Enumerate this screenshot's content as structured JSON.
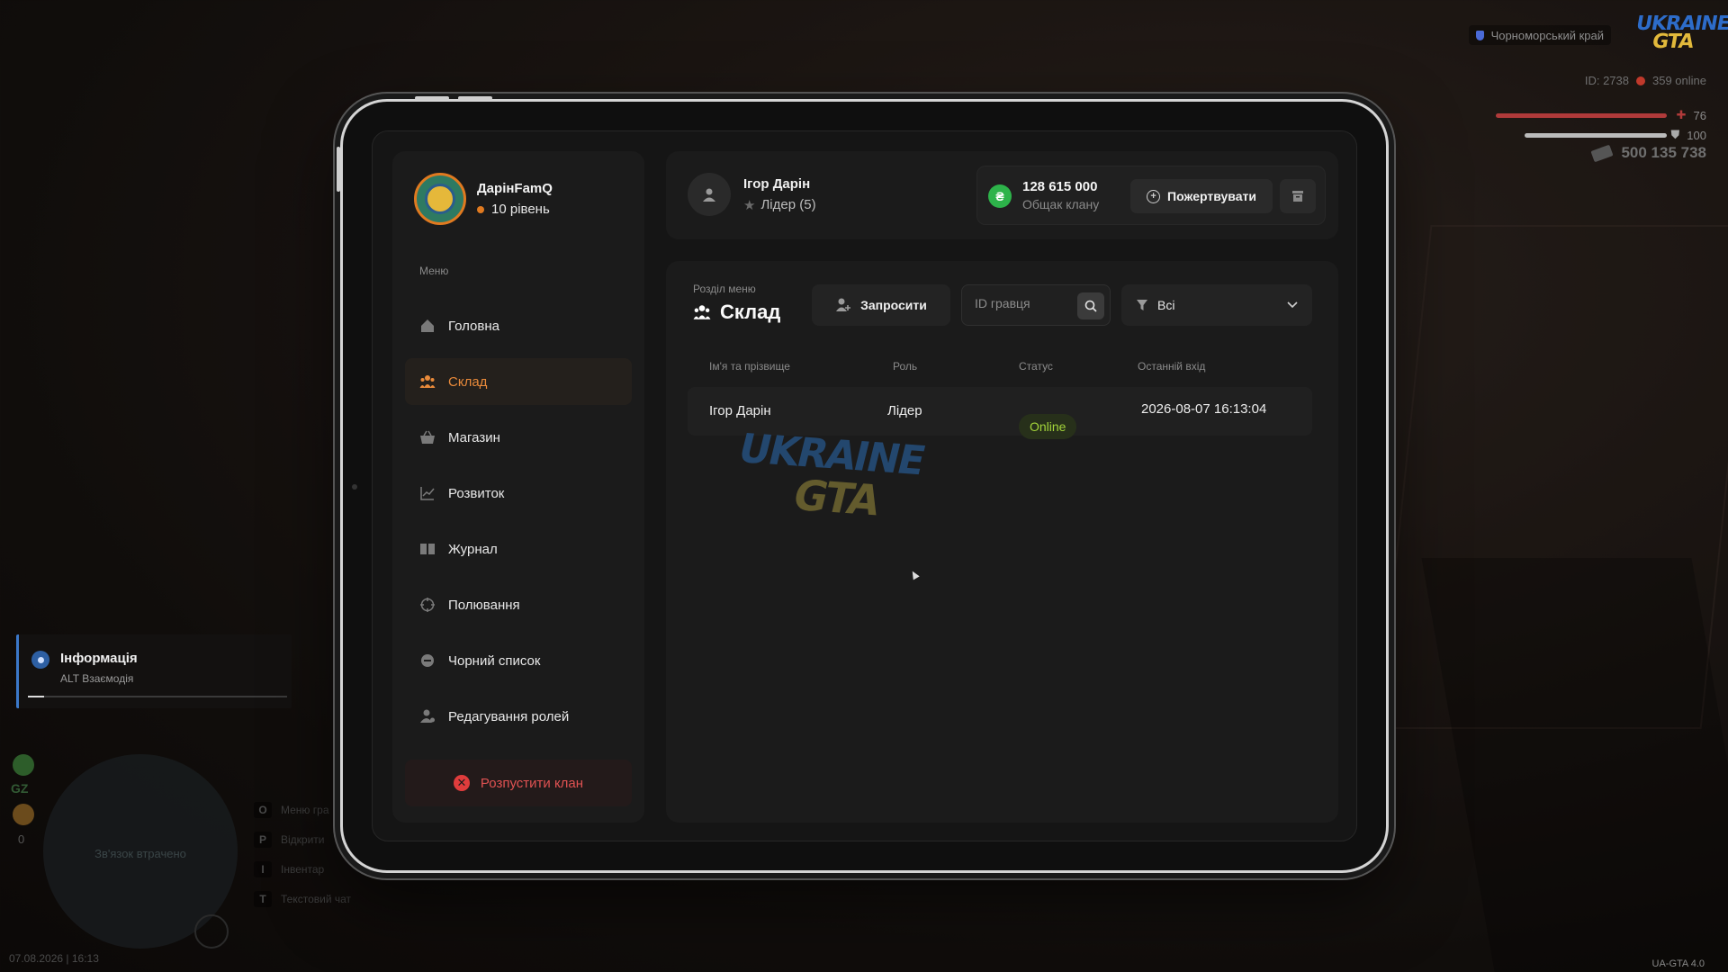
{
  "hud": {
    "server_name": "Чорноморський край",
    "logo_line1": "UKRAINE",
    "logo_line2": "GTA",
    "player_id": "ID: 2738",
    "online": "359 online",
    "health": "76",
    "armor": "100",
    "money": "500 135 738",
    "datetime": "07.08.2026 | 16:13",
    "version": "UA-GTA 4.0"
  },
  "info": {
    "title": "Інформація",
    "subtitle": "ALT Взаємодія"
  },
  "minimap": {
    "status": "Зв'язок втрачено",
    "gz": "GZ",
    "gz_count": "0"
  },
  "hotkeys": [
    {
      "key": "O",
      "label": "Меню гра"
    },
    {
      "key": "P",
      "label": "Відкрити"
    },
    {
      "key": "I",
      "label": "Інвентар"
    },
    {
      "key": "T",
      "label": "Текстовий чат"
    }
  ],
  "sidebar": {
    "clan_name": "ДарінFamQ",
    "level": "10 рівень",
    "menu_label": "Меню",
    "items": [
      {
        "label": "Головна",
        "icon": "home-icon"
      },
      {
        "label": "Склад",
        "icon": "people-icon",
        "active": true
      },
      {
        "label": "Магазин",
        "icon": "basket-icon"
      },
      {
        "label": "Розвиток",
        "icon": "chart-icon"
      },
      {
        "label": "Журнал",
        "icon": "book-icon"
      },
      {
        "label": "Полювання",
        "icon": "crosshair-icon"
      },
      {
        "label": "Чорний список",
        "icon": "block-icon"
      },
      {
        "label": "Редагування ролей",
        "icon": "user-edit-icon"
      }
    ],
    "disband_label": "Розпустити клан"
  },
  "top": {
    "user_name": "Ігор Дарін",
    "user_role": "Лідер (5)",
    "bank_amount": "128 615 000",
    "bank_label": "Общак клану",
    "donate_label": "Пожертвувати"
  },
  "main": {
    "section_label": "Розділ меню",
    "section_title": "Склад",
    "invite_label": "Запросити",
    "search_placeholder": "ID гравця",
    "filter_value": "Всі",
    "watermark_line1": "UKRAINE",
    "watermark_line2": "GTA",
    "columns": [
      "Ім'я та прізвище",
      "Роль",
      "Статус",
      "Останній вхід"
    ],
    "rows": [
      {
        "name": "Ігор Дарін",
        "role": "Лідер",
        "status": "Online",
        "last_login": "2026-08-07 16:13:04"
      }
    ]
  },
  "colors": {
    "accent": "#e98a3a",
    "danger": "#e05252",
    "online": "#a3d43a",
    "money": "#2db34a"
  }
}
